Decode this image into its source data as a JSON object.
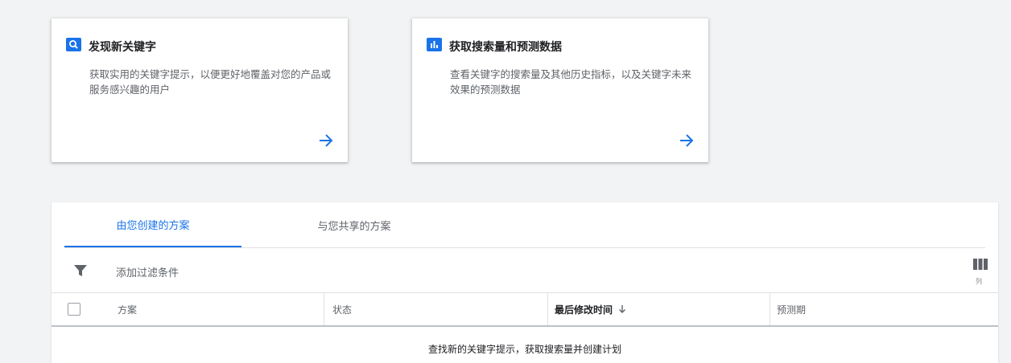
{
  "cards": [
    {
      "icon": "search-icon",
      "title": "发现新关键字",
      "description": "获取实用的关键字提示，以便更好地覆盖对您的产品或服务感兴趣的用户"
    },
    {
      "icon": "bar-chart-icon",
      "title": "获取搜索量和预测数据",
      "description": "查看关键字的搜索量及其他历史指标，以及关键字未来效果的预测数据"
    }
  ],
  "tabs": [
    {
      "label": "由您创建的方案",
      "active": true
    },
    {
      "label": "与您共享的方案",
      "active": false
    }
  ],
  "filter": {
    "label": "添加过滤条件"
  },
  "columns_button": {
    "label": "列"
  },
  "table": {
    "headers": [
      "方案",
      "状态",
      "最后修改时间",
      "预测期"
    ],
    "sorted_column": "最后修改时间",
    "empty_message": "查找新的关键字提示，获取搜索量并创建计划"
  },
  "colors": {
    "accent": "#1a73e8",
    "background": "#f1f3f4"
  }
}
